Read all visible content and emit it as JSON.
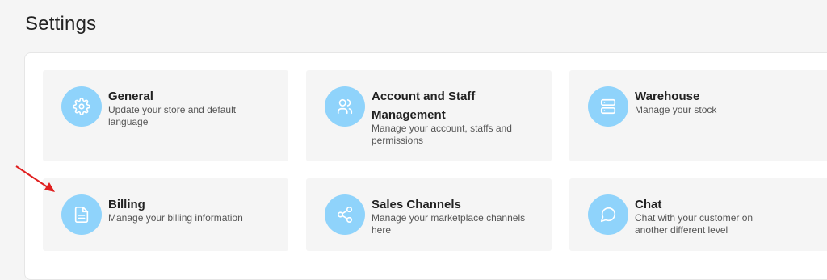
{
  "page": {
    "title": "Settings"
  },
  "cards": [
    {
      "title": "General",
      "description": "Update your store and default language",
      "icon": "gear-icon"
    },
    {
      "title": "Account and Staff Management",
      "description": "Manage your account, staffs and permissions",
      "icon": "users-icon"
    },
    {
      "title": "Warehouse",
      "description": "Manage your stock",
      "icon": "server-icon"
    },
    {
      "title": "Billing",
      "description": "Manage your billing information",
      "icon": "document-icon"
    },
    {
      "title": "Sales Channels",
      "description": "Manage your marketplace channels here",
      "icon": "share-icon"
    },
    {
      "title": "Chat",
      "description": "Chat with your customer on another different level",
      "icon": "chat-bubble-icon"
    }
  ],
  "colors": {
    "icon_bg": "#8fd3fb",
    "card_bg": "#f5f5f5",
    "arrow": "#e02020"
  }
}
